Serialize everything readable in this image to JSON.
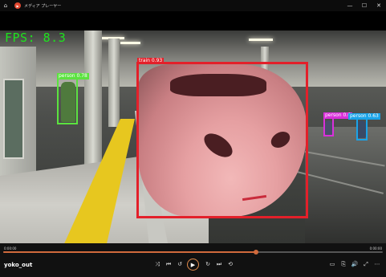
{
  "window": {
    "title": "メディア プレーヤー",
    "home_icon": "home-icon",
    "app_icon": "media-player-icon",
    "minimize": "—",
    "maximize": "☐",
    "close": "✕"
  },
  "overlay": {
    "fps_text": "FPS: 8.3"
  },
  "detections": [
    {
      "label": "train 0.93",
      "color": "#e3202a"
    },
    {
      "label": "person 0.78",
      "color": "#5be33f"
    },
    {
      "label": "person 0.6",
      "color": "#d930d9"
    },
    {
      "label": "person 0.63",
      "color": "#1aa3e8"
    }
  ],
  "player": {
    "time_elapsed": "0:00:00",
    "time_remaining": "0:00:00",
    "progress": 0.665,
    "accent": "#d06a3c",
    "media_title": "yoko_out",
    "buttons": {
      "shuffle": "⤨",
      "previous": "⏮",
      "rewind": "↺",
      "play": "▶",
      "forward": "↻",
      "next": "⏭",
      "repeat": "⟲",
      "miniplayer": "▭",
      "cast": "⎘",
      "volume": "🔊",
      "fullscreen": "⤢",
      "more": "⋯"
    }
  }
}
